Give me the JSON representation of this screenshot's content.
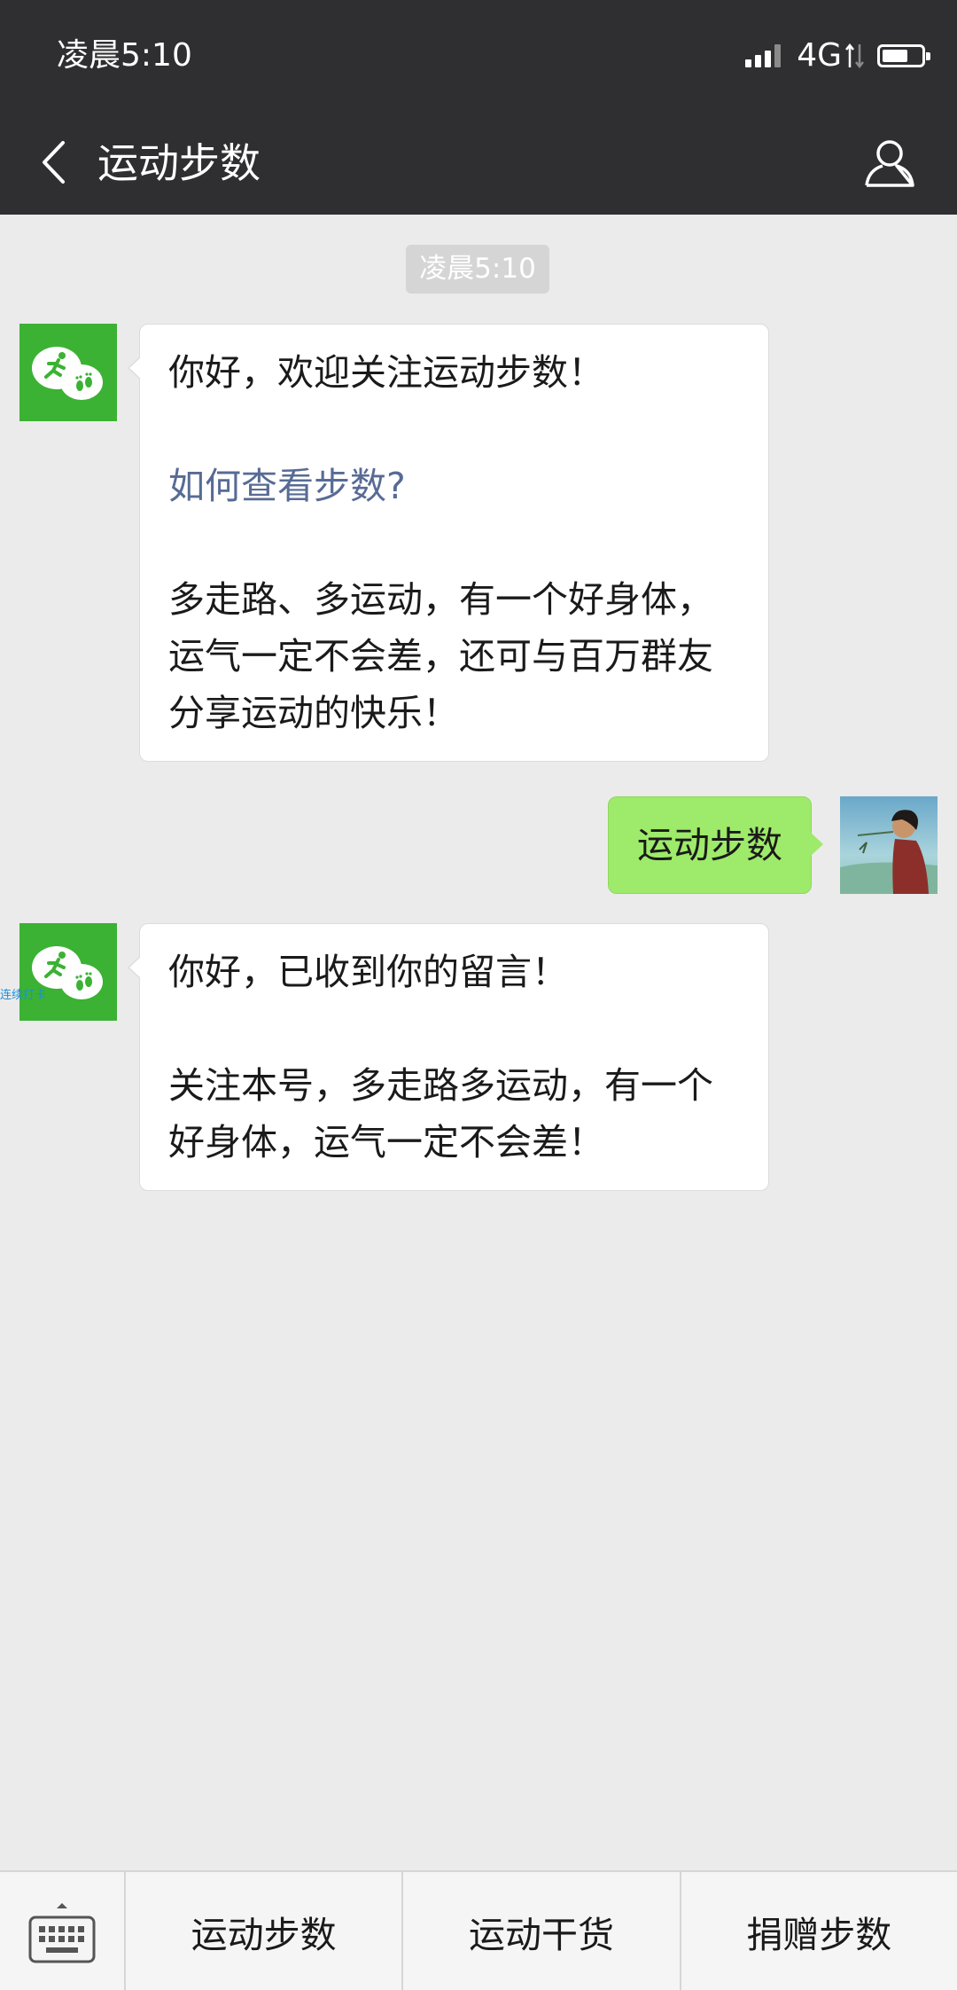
{
  "status_bar": {
    "time": "凌晨5:10",
    "network": "4G"
  },
  "nav": {
    "title": "运动步数",
    "back_icon": "chevron-left-icon",
    "profile_icon": "person-icon"
  },
  "chat": {
    "timestamp": "凌晨5:10",
    "messages": [
      {
        "from": "bot",
        "greeting": "你好，欢迎关注运动步数！",
        "link": "如何查看步数?",
        "body": "多走路、多运动，有一个好身体，运气一定不会差，还可与百万群友分享运动的快乐！"
      },
      {
        "from": "user",
        "text": "运动步数"
      },
      {
        "from": "bot",
        "greeting": "你好，已收到你的留言！",
        "body": "关注本号，多走路多运动，有一个好身体，运气一定不会差！"
      }
    ],
    "overlay_label": "连续打卡"
  },
  "bottom_menu": {
    "keyboard_icon": "keyboard-icon",
    "items": [
      "运动步数",
      "运动干货",
      "捐赠步数"
    ]
  },
  "colors": {
    "header_bg": "#2f2f31",
    "chat_bg": "#ebebeb",
    "sent_bubble": "#9eea6a",
    "bot_avatar": "#3bb233",
    "link": "#576b95"
  }
}
